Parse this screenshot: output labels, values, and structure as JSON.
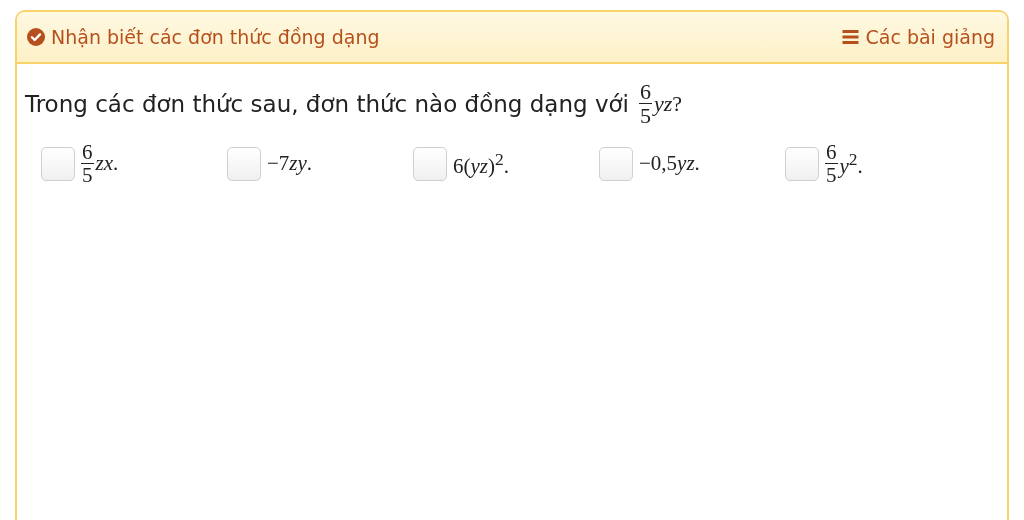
{
  "header": {
    "title": "Nhận biết các đơn thức đồng dạng",
    "lessons_link": "Các bài giảng"
  },
  "question": {
    "text": "Trong các đơn thức sau, đơn thức nào đồng dạng với",
    "fraction": {
      "numerator": "6",
      "denominator": "5"
    },
    "expression": "*yz*?"
  },
  "options": [
    {
      "checked": false,
      "fraction": {
        "numerator": "6",
        "denominator": "5"
      },
      "expression": "*zx*."
    },
    {
      "checked": false,
      "lead": "−7",
      "expression": "*zy*."
    },
    {
      "checked": false,
      "expression": "6(*yz*)$^{2}$."
    },
    {
      "checked": false,
      "lead": "−0,5",
      "expression": "*yz*."
    },
    {
      "checked": false,
      "fraction": {
        "numerator": "6",
        "denominator": "5"
      },
      "expression": "*y*$^{2}$."
    }
  ]
}
